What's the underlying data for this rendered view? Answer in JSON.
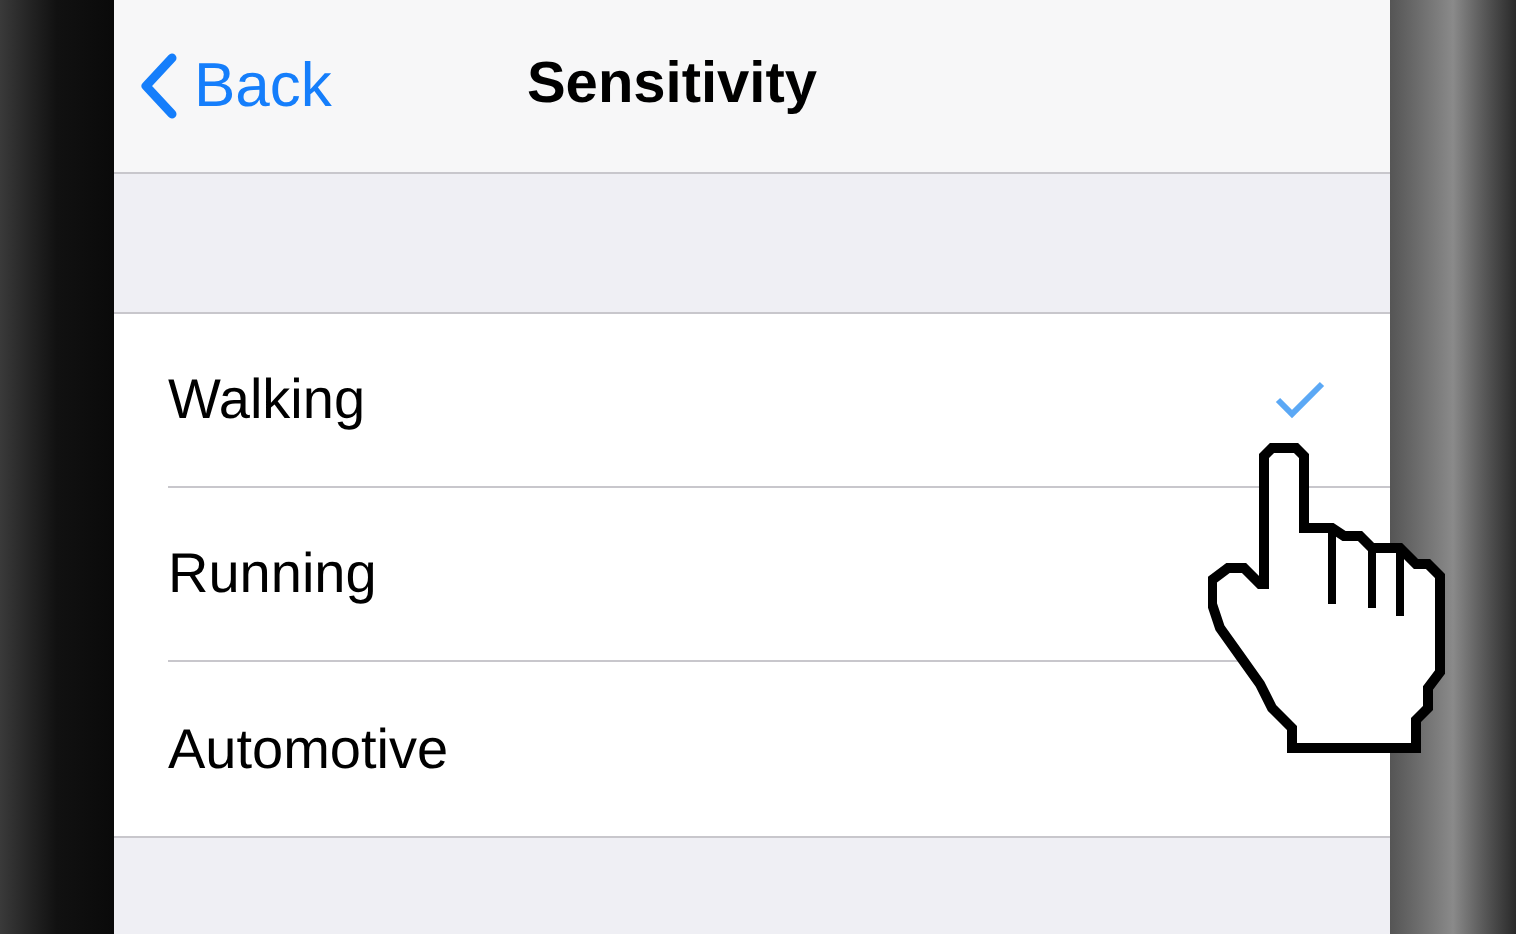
{
  "nav_bar": {
    "back_label": "Back",
    "title": "Sensitivity"
  },
  "options": [
    {
      "label": "Walking",
      "selected": true
    },
    {
      "label": "Running"
    },
    {
      "label": "Automotive",
      "selected": false
    }
  ]
}
